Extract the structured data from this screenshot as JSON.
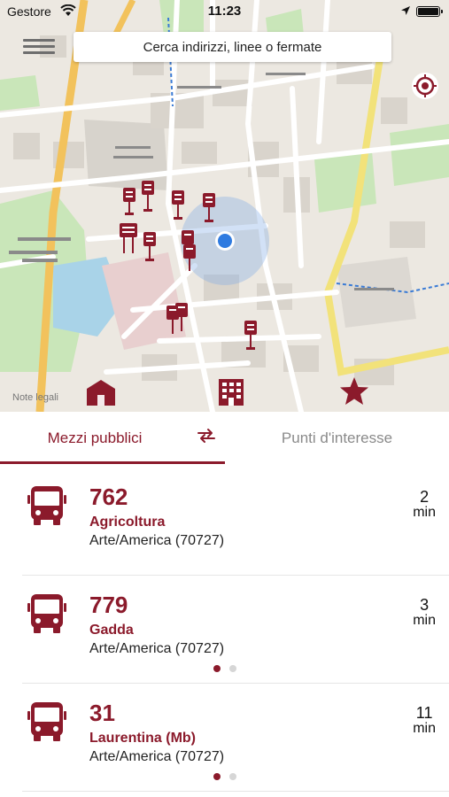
{
  "status_bar": {
    "carrier": "Gestore",
    "time": "11:23"
  },
  "search": {
    "placeholder": "Cerca indirizzi, linee o fermate"
  },
  "map": {
    "legal_notice": "Note legali"
  },
  "tabs": [
    {
      "label": "Mezzi pubblici",
      "active": true
    },
    {
      "label": "Punti d'interesse",
      "active": false
    }
  ],
  "arrivals": [
    {
      "line": "762",
      "destination": "Agricoltura",
      "stop": "Arte/America (70727)",
      "minutes": "2",
      "unit": "min",
      "pager_dots": 0
    },
    {
      "line": "779",
      "destination": "Gadda",
      "stop": "Arte/America (70727)",
      "minutes": "3",
      "unit": "min",
      "pager_dots": 2
    },
    {
      "line": "31",
      "destination": "Laurentina (Mb)",
      "stop": "Arte/America (70727)",
      "minutes": "11",
      "unit": "min",
      "pager_dots": 2
    }
  ],
  "colors": {
    "accent": "#8b1a2b",
    "inactive_tab": "#8a8a8a",
    "location_dot": "#2f7be0"
  }
}
